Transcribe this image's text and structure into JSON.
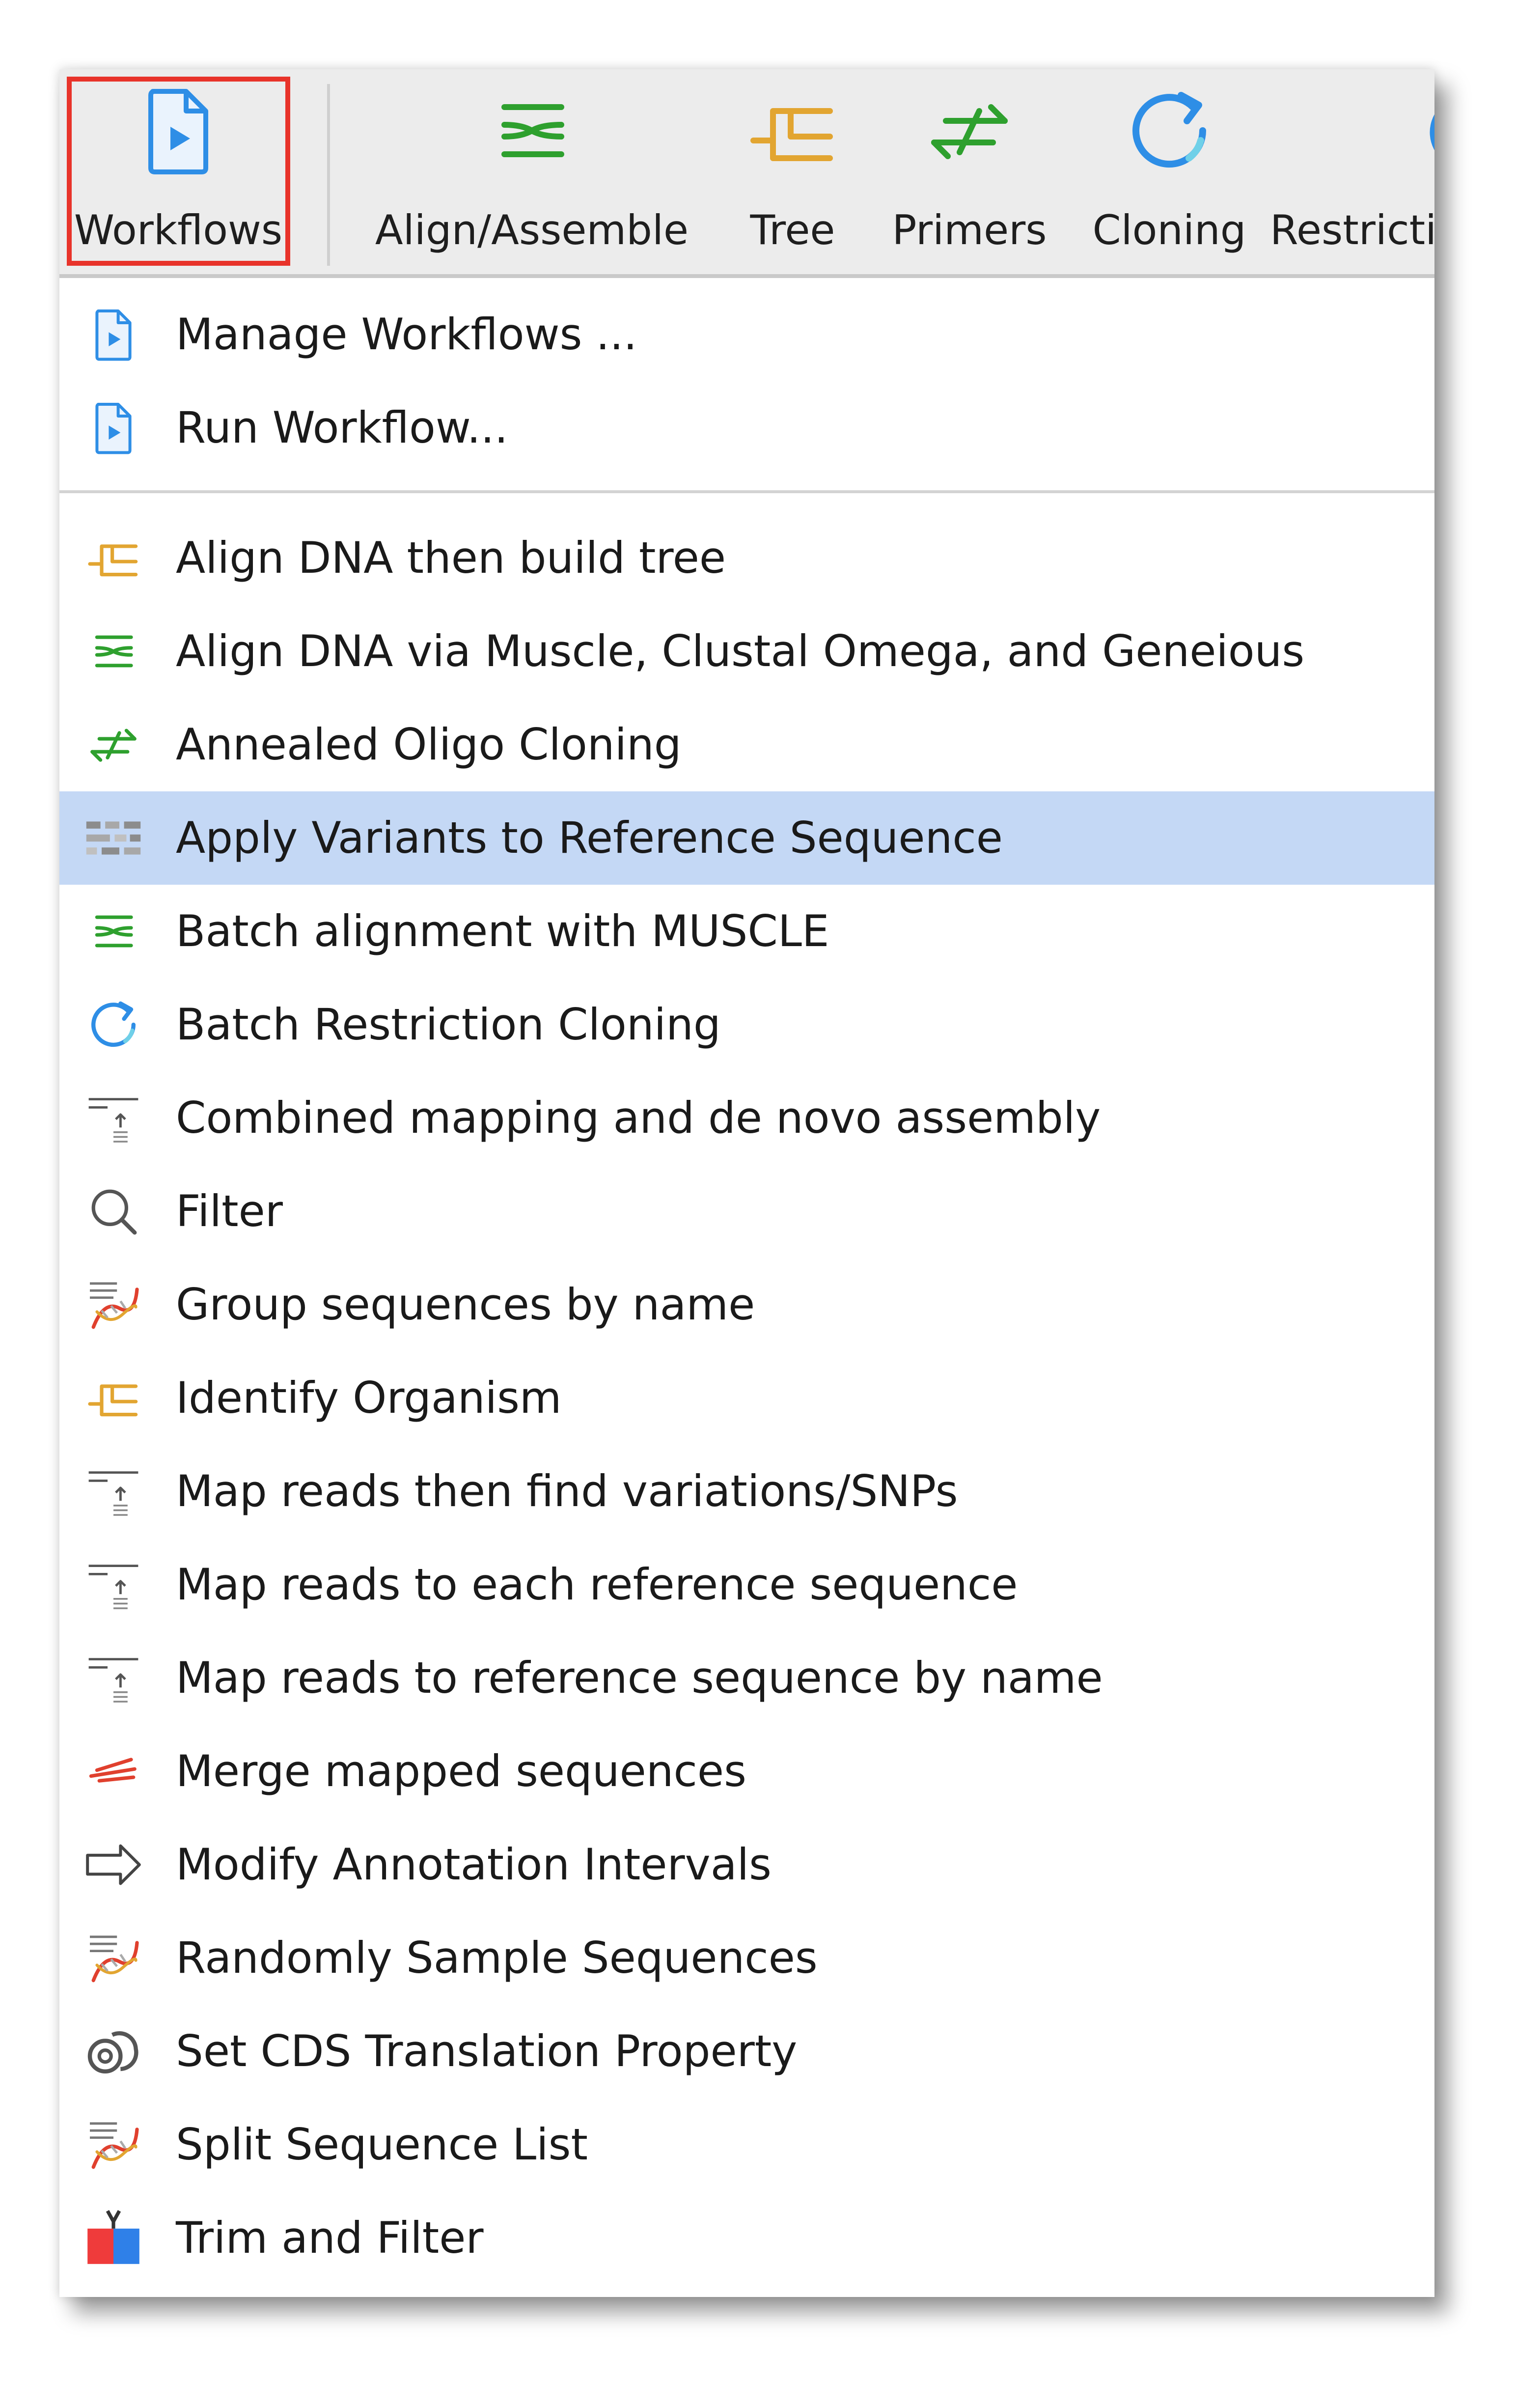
{
  "toolbar": {
    "buttons": [
      {
        "label": "Workflows",
        "icon": "workflow-icon"
      },
      {
        "label": "Align/Assemble",
        "icon": "align-icon"
      },
      {
        "label": "Tree",
        "icon": "tree-icon"
      },
      {
        "label": "Primers",
        "icon": "primers-icon"
      },
      {
        "label": "Cloning",
        "icon": "cloning-icon"
      },
      {
        "label": "Restricti",
        "icon": "restriction-icon"
      }
    ],
    "highlighted": "Workflows"
  },
  "menu": {
    "group1": [
      {
        "label": "Manage Workflows ...",
        "icon": "workflow-icon"
      },
      {
        "label": "Run Workflow...",
        "icon": "workflow-icon"
      }
    ],
    "group2": [
      {
        "label": "Align DNA then build tree",
        "icon": "tree-icon"
      },
      {
        "label": "Align DNA via Muscle, Clustal Omega, and Geneious",
        "icon": "align-icon"
      },
      {
        "label": "Annealed Oligo Cloning",
        "icon": "primers-icon"
      },
      {
        "label": "Apply Variants to Reference Sequence",
        "icon": "variants-icon",
        "selected": true
      },
      {
        "label": "Batch alignment with MUSCLE",
        "icon": "align-icon"
      },
      {
        "label": "Batch Restriction Cloning",
        "icon": "cloning-icon"
      },
      {
        "label": "Combined mapping and de novo assembly",
        "icon": "map-reads-icon"
      },
      {
        "label": "Filter",
        "icon": "search-icon"
      },
      {
        "label": "Group sequences by name",
        "icon": "sequence-list-icon"
      },
      {
        "label": "Identify Organism",
        "icon": "tree-icon"
      },
      {
        "label": "Map reads then find variations/SNPs",
        "icon": "map-reads-icon"
      },
      {
        "label": "Map reads to each reference sequence",
        "icon": "map-reads-icon"
      },
      {
        "label": "Map reads to reference sequence by name",
        "icon": "map-reads-icon"
      },
      {
        "label": "Merge mapped sequences",
        "icon": "merge-icon"
      },
      {
        "label": "Modify Annotation Intervals",
        "icon": "arrow-right-icon"
      },
      {
        "label": "Randomly Sample Sequences",
        "icon": "sequence-list-icon"
      },
      {
        "label": "Set CDS Translation Property",
        "icon": "translation-icon"
      },
      {
        "label": "Split Sequence List",
        "icon": "sequence-list-icon"
      },
      {
        "label": "Trim and Filter",
        "icon": "trim-icon"
      }
    ]
  },
  "colors": {
    "highlight_border": "#e8332a",
    "selected_row": "#c4d8f5",
    "toolbar_bg": "#ececec",
    "blue_icon": "#2e8ee6",
    "green_icon": "#2ea02e",
    "gold_icon": "#e2a531",
    "red_icon": "#e0402e"
  }
}
